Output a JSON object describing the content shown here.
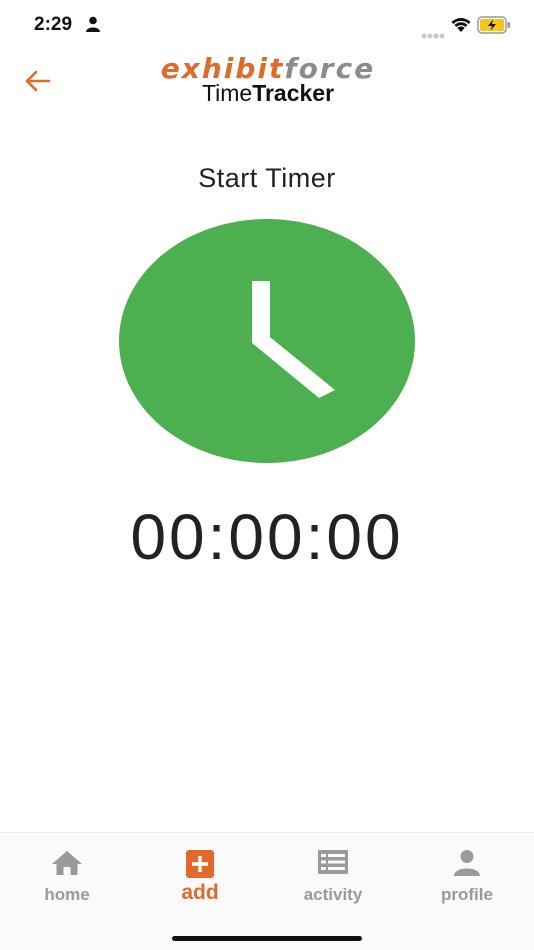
{
  "status_bar": {
    "time": "2:29",
    "person_icon": "person-icon",
    "signal_icon": "cellular-signal-icon",
    "wifi_icon": "wifi-icon",
    "battery_icon": "battery-charging-icon",
    "battery_color": "#f5c518"
  },
  "header": {
    "back_icon": "back-arrow-icon",
    "logo": {
      "brand_part1": "exhibit",
      "brand_part2": "force",
      "product_part1": "Time",
      "product_part2": "Tracker"
    }
  },
  "main": {
    "title": "Start Timer",
    "timer_icon": "clock-icon",
    "timer_value": "00:00:00"
  },
  "bottom_nav": {
    "items": [
      {
        "label": "home",
        "icon": "home-icon",
        "active": false
      },
      {
        "label": "add",
        "icon": "add-box-icon",
        "active": true
      },
      {
        "label": "activity",
        "icon": "list-icon",
        "active": false
      },
      {
        "label": "profile",
        "icon": "profile-icon",
        "active": false
      }
    ]
  },
  "colors": {
    "accent": "#e06a2b",
    "timer_green": "#4caf50",
    "inactive_nav": "#9a9a9a",
    "brand_gray": "#8c8c8c"
  }
}
